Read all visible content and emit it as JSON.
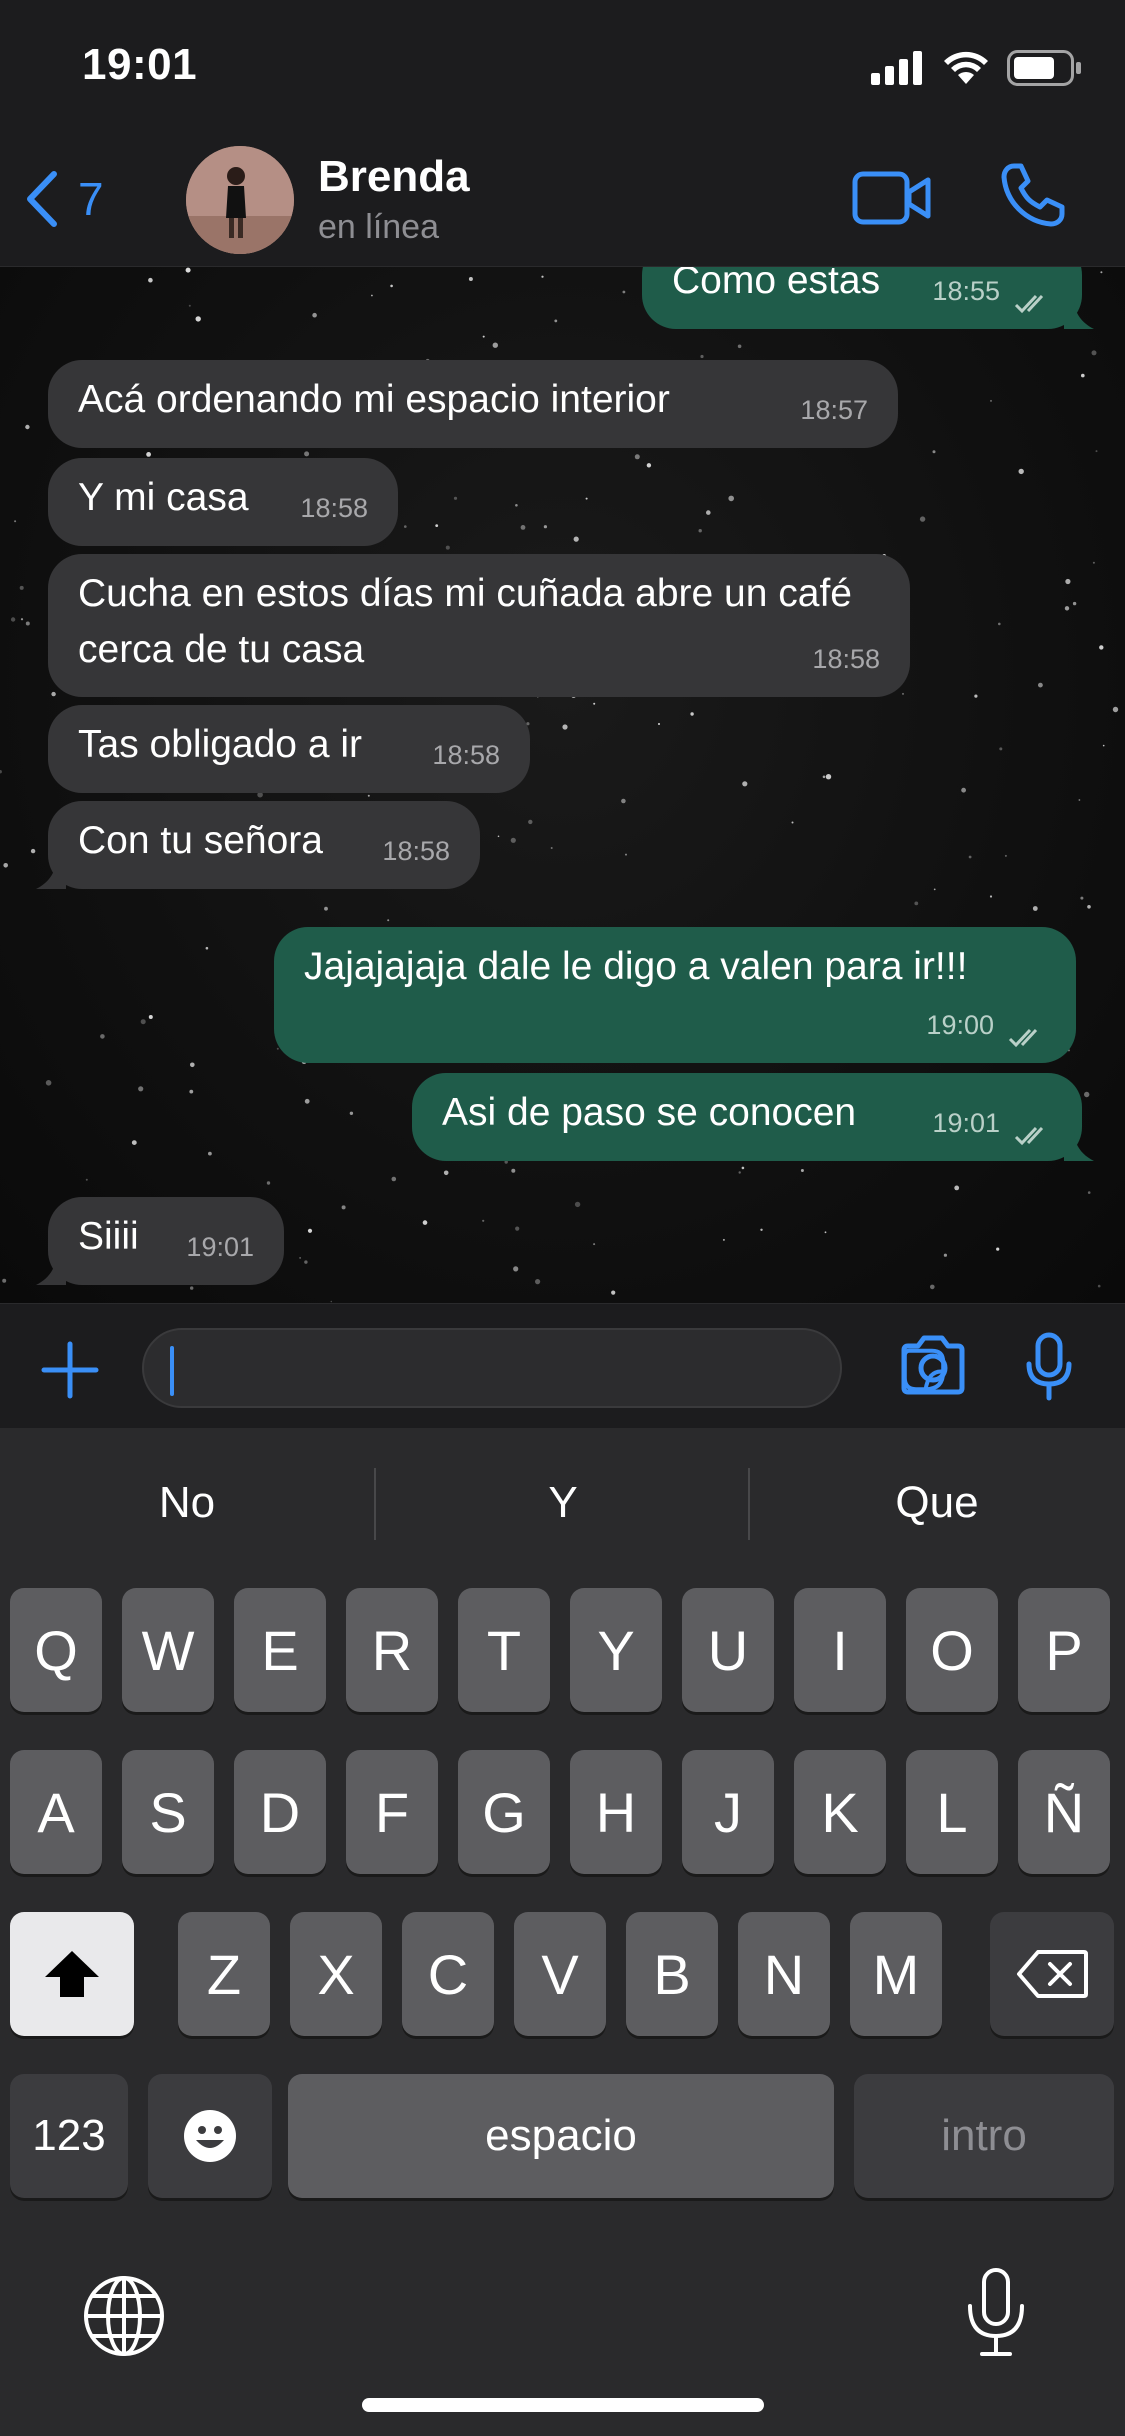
{
  "status_bar": {
    "time": "19:01"
  },
  "header": {
    "back_count": "7",
    "contact_name": "Brenda",
    "contact_status": "en línea"
  },
  "messages": [
    {
      "direction": "out",
      "text": "Como estas",
      "time": "18:55"
    },
    {
      "direction": "in",
      "text": "Acá ordenando mi espacio interior",
      "time": "18:57"
    },
    {
      "direction": "in",
      "text": "Y mi casa",
      "time": "18:58"
    },
    {
      "direction": "in",
      "text": "Cucha en estos días mi cuñada abre un café cerca de tu casa",
      "time": "18:58"
    },
    {
      "direction": "in",
      "text": "Tas obligado a ir",
      "time": "18:58"
    },
    {
      "direction": "in",
      "text": "Con tu señora",
      "time": "18:58"
    },
    {
      "direction": "out",
      "text": "Jajajajaja dale le digo a valen para ir!!!",
      "time": "19:00"
    },
    {
      "direction": "out",
      "text": "Asi de paso se conocen",
      "time": "19:01"
    },
    {
      "direction": "in",
      "text": "Siiii",
      "time": "19:01"
    }
  ],
  "input": {
    "value": ""
  },
  "keyboard": {
    "suggestions": [
      "No",
      "Y",
      "Que"
    ],
    "row1": [
      "Q",
      "W",
      "E",
      "R",
      "T",
      "Y",
      "U",
      "I",
      "O",
      "P"
    ],
    "row2": [
      "A",
      "S",
      "D",
      "F",
      "G",
      "H",
      "J",
      "K",
      "L",
      "Ñ"
    ],
    "row3": [
      "Z",
      "X",
      "C",
      "V",
      "B",
      "N",
      "M"
    ],
    "numbers_label": "123",
    "space_label": "espacio",
    "return_label": "intro"
  },
  "colors": {
    "accent": "#3a8ff7",
    "incoming_bubble": "#363638",
    "outgoing_bubble": "#1f5c4a"
  }
}
